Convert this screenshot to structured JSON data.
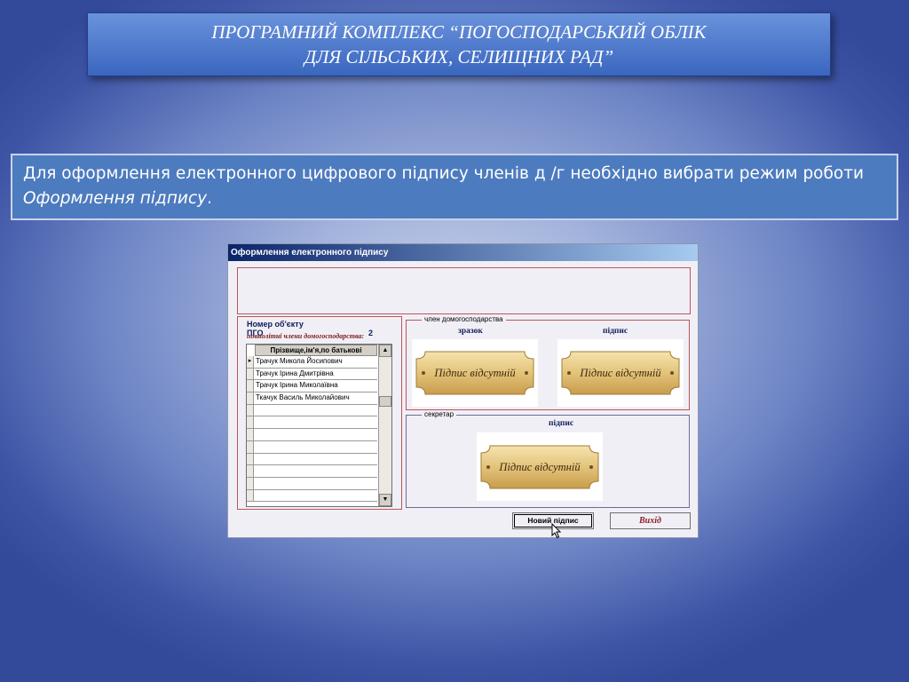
{
  "slide": {
    "title_line1": "ПРОГРАМНИЙ КОМПЛЕКС “ПОГОСПОДАРСЬКИЙ ОБЛІК",
    "title_line2": "ДЛЯ СІЛЬСЬКИХ, СЕЛИЩНИХ РАД”",
    "info_text_plain": "Для оформлення електронного цифрового підпису членів д /г необхідно вибрати режим роботи ",
    "info_text_italic": "Оформлення підпису",
    "info_text_end": "."
  },
  "window": {
    "title": "Оформлення електронного підпису",
    "object_label": "Номер об'єкту  ПГО",
    "object_number": "2",
    "members_caption": "повнолітні члени домогосподарства:",
    "grid_header": "Прізвище,ім'я,по батькові",
    "members": [
      "Трачук Микола Йосипович",
      "Трачук Ірина Дмитрівна",
      "Трачук Ірина Миколаївна",
      "Ткачук Василь Миколайович"
    ],
    "member_group_label": "член домогосподарства",
    "sample_label": "зразок",
    "signature_label": "підпис",
    "secretary_group_label": "секретар",
    "secretary_signature_label": "підпис",
    "no_signature_text": "Підпис відсутній",
    "new_signature_button": "Новий  підпис",
    "exit_button": "Вихід"
  },
  "colors": {
    "title_bar_start": "#0a246a",
    "title_bar_end": "#a6caf0",
    "frame_red": "#b8565a",
    "plaque_gold": "#e9cf8c"
  }
}
